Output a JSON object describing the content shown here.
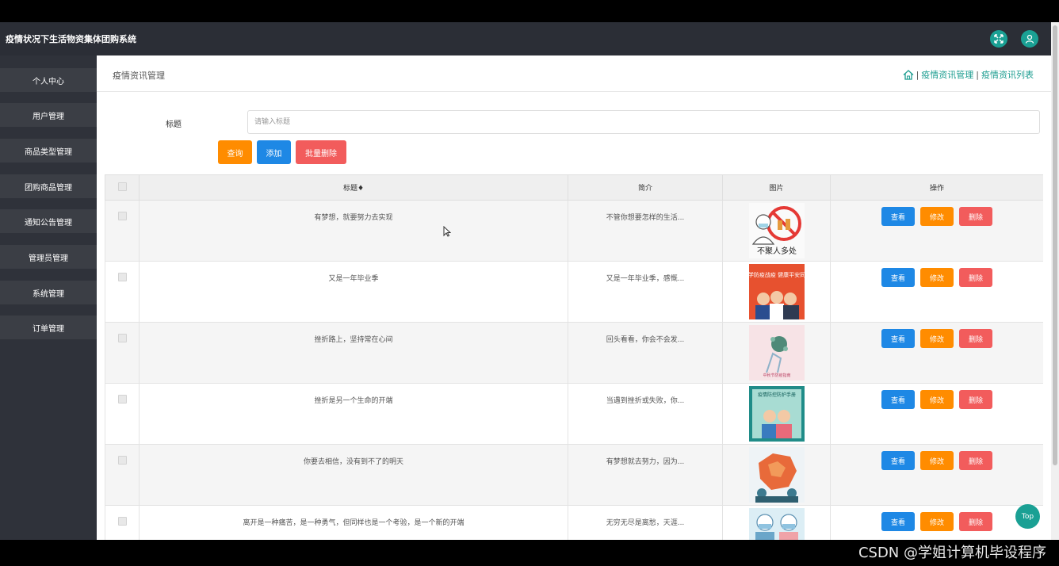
{
  "header": {
    "title": "疫情状况下生活物资集体团购系统",
    "icons": [
      "fullscreen-icon",
      "user-icon"
    ]
  },
  "sidebar": {
    "items": [
      {
        "label": "个人中心"
      },
      {
        "label": "用户管理"
      },
      {
        "label": "商品类型管理"
      },
      {
        "label": "团购商品管理"
      },
      {
        "label": "通知公告管理"
      },
      {
        "label": "管理员管理"
      },
      {
        "label": "系统管理"
      },
      {
        "label": "订单管理"
      }
    ]
  },
  "page": {
    "title": "疫情资讯管理",
    "breadcrumb": [
      "疫情资讯管理",
      "疫情资讯列表"
    ],
    "separator": "|"
  },
  "search": {
    "label": "标题",
    "placeholder": "请输入标题",
    "value": ""
  },
  "buttons": {
    "query": "查询",
    "add": "添加",
    "batch_delete": "批量删除"
  },
  "table": {
    "columns": [
      "",
      "标题♦",
      "简介",
      "图片",
      "操作"
    ],
    "rows": [
      {
        "title": "有梦想，就要努力去实现",
        "summary": "不管你想要怎样的生活..."
      },
      {
        "title": "又是一年毕业季",
        "summary": "又是一年毕业季，感慨..."
      },
      {
        "title": "挫折路上，坚持常在心间",
        "summary": "回头看看，你会不会发..."
      },
      {
        "title": "挫折是另一个生命的开端",
        "summary": "当遇到挫折或失败，你..."
      },
      {
        "title": "你要去相信，没有到不了的明天",
        "summary": "有梦想就去努力，因为..."
      },
      {
        "title": "离开是一种痛苦，是一种勇气，但同样也是一个考验，是一个新的开端",
        "summary": "无穷无尽是离愁，天涯..."
      }
    ],
    "actions": {
      "view": "查看",
      "edit": "修改",
      "delete": "删除"
    }
  },
  "images": [
    {
      "text": "不聚人多处"
    },
    {
      "text": "科学防疫战疫 健康平安同行"
    },
    {
      "text": "中秋节防疫指南"
    },
    {
      "text": "疫情防控防护手册"
    },
    {
      "text": ""
    },
    {
      "text": ""
    }
  ],
  "top_button": "Top",
  "watermark": "CSDN @学姐计算机毕设程序",
  "colors": {
    "accent": "#1aa094",
    "view": "#1e88e5",
    "edit": "#ff8c00",
    "delete": "#f25c5c",
    "sidebar": "#2f323a",
    "header": "#2b2e36"
  }
}
